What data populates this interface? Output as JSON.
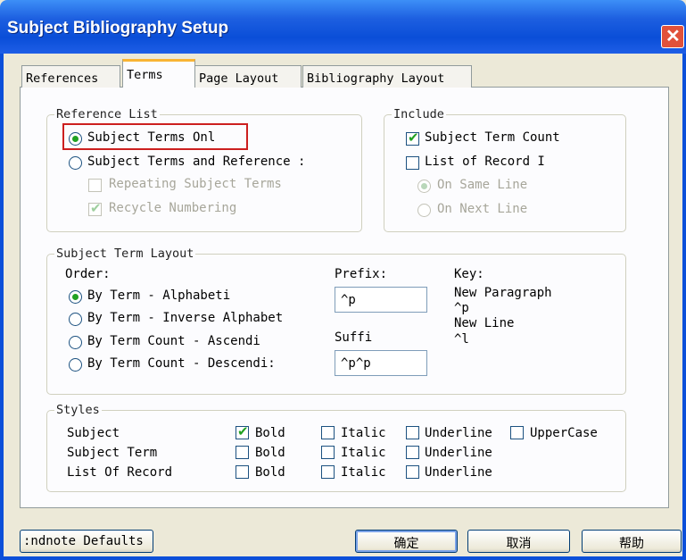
{
  "window": {
    "title": "Subject Bibliography Setup"
  },
  "tabs": [
    {
      "label": "References"
    },
    {
      "label": "Terms"
    },
    {
      "label": "Page Layout"
    },
    {
      "label": "Bibliography Layout"
    }
  ],
  "reference_list": {
    "legend": "Reference List",
    "options": [
      {
        "label": "Subject Terms Onl",
        "selected": true,
        "enabled": true
      },
      {
        "label": "Subject Terms and Reference :",
        "selected": false,
        "enabled": true
      }
    ],
    "checks": [
      {
        "label": "Repeating Subject Terms",
        "checked": false,
        "enabled": false
      },
      {
        "label": "Recycle Numbering",
        "checked": true,
        "enabled": false
      }
    ]
  },
  "include": {
    "legend": "Include",
    "checks": [
      {
        "label": "Subject Term Count",
        "checked": true
      },
      {
        "label": "List of Record I",
        "checked": false
      }
    ],
    "options": [
      {
        "label": "On Same Line",
        "selected": true,
        "enabled": false
      },
      {
        "label": "On Next Line",
        "selected": false,
        "enabled": false
      }
    ]
  },
  "term_layout": {
    "legend": "Subject Term Layout",
    "order_label": "Order:",
    "order_options": [
      {
        "label": "By Term - Alphabeti",
        "selected": true
      },
      {
        "label": "By Term - Inverse Alphabet",
        "selected": false
      },
      {
        "label": "By Term Count - Ascendi",
        "selected": false
      },
      {
        "label": "By Term Count - Descendi:",
        "selected": false
      }
    ],
    "prefix_label": "Prefix:",
    "prefix_value": "^p",
    "suffix_label": "Suffi",
    "suffix_value": "^p^p",
    "key_label": "Key:",
    "key_lines": [
      "New Paragraph",
      "^p",
      "New Line",
      "^l"
    ]
  },
  "styles": {
    "legend": "Styles",
    "rows": [
      {
        "label": "Subject",
        "bold": true,
        "italic": false,
        "underline": false,
        "uppercase": false
      },
      {
        "label": "Subject Term",
        "bold": false,
        "italic": false,
        "underline": false
      },
      {
        "label": "List Of Record",
        "bold": false,
        "italic": false,
        "underline": false
      }
    ],
    "bold_label": "Bold",
    "italic_label": "Italic",
    "underline_label": "Underline",
    "uppercase_label": "UpperCase"
  },
  "buttons": {
    "defaults": ":ndnote Defaults",
    "ok": "确定",
    "cancel": "取消",
    "help": "帮助"
  },
  "colors": {
    "title_bar": "#0a4ed8",
    "highlight": "#cc1f1f",
    "check": "#21a121"
  }
}
